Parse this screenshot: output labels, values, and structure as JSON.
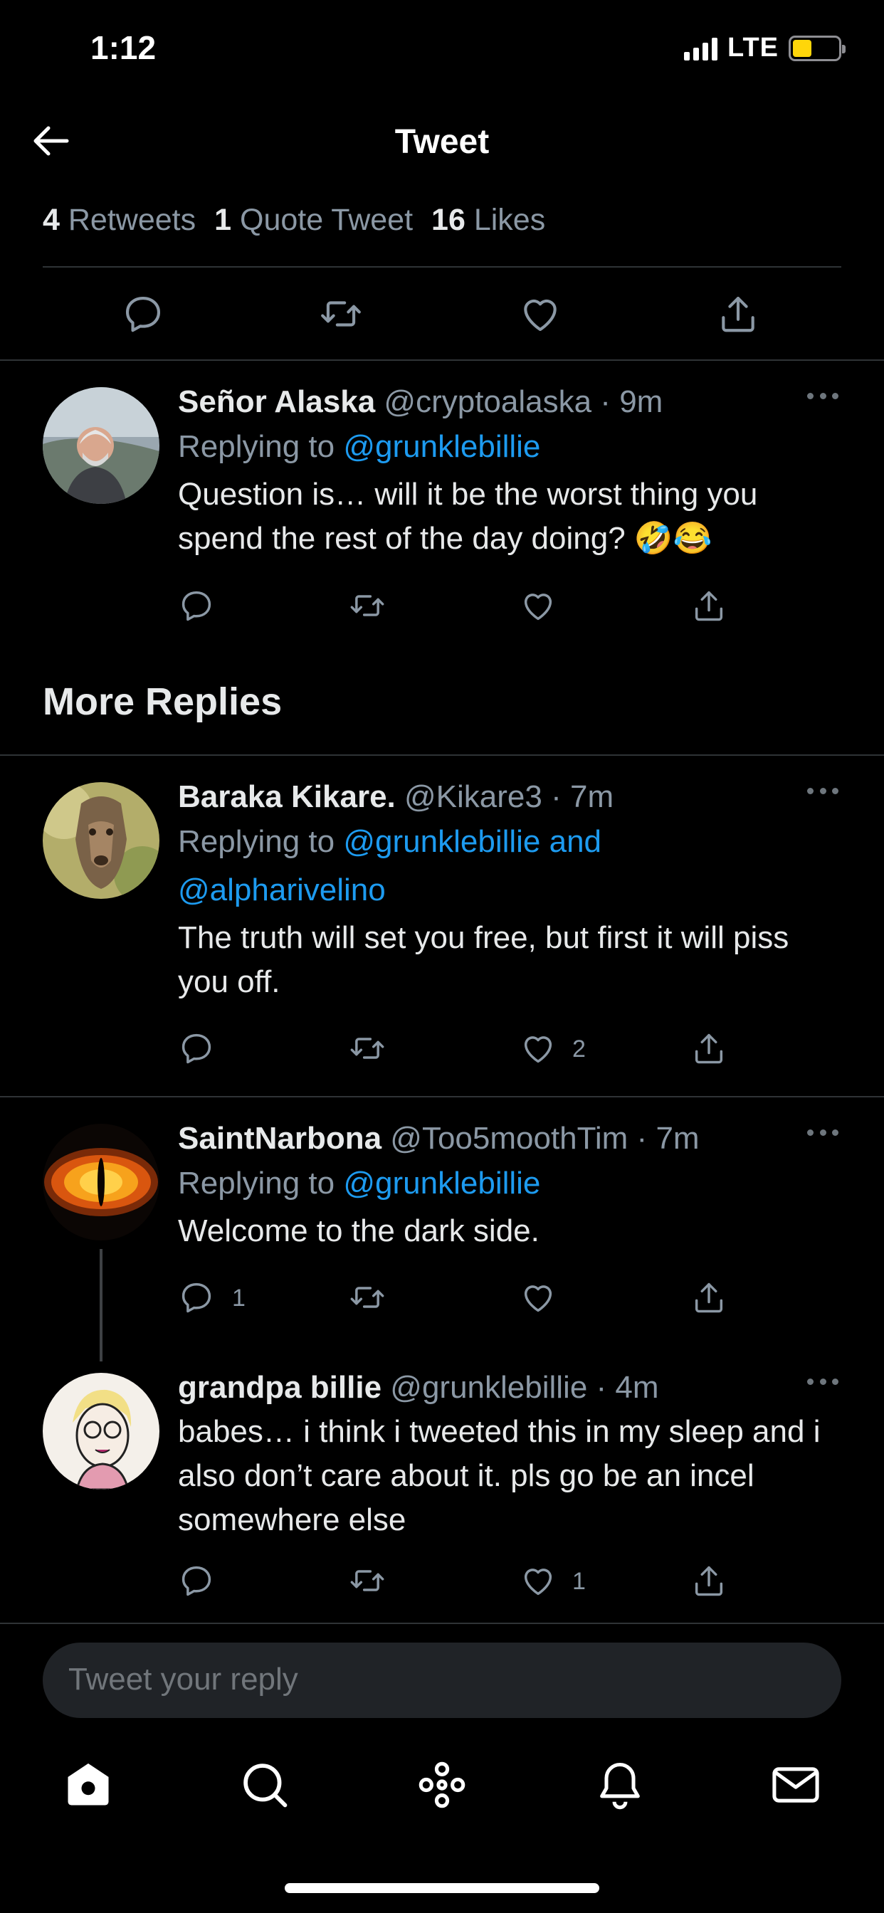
{
  "status_bar": {
    "time": "1:12",
    "network": "LTE"
  },
  "nav": {
    "title": "Tweet"
  },
  "stats": [
    {
      "count": "4",
      "label": "Retweets"
    },
    {
      "count": "1",
      "label": "Quote Tweet"
    },
    {
      "count": "16",
      "label": "Likes"
    }
  ],
  "section_title": "More Replies",
  "tweets": [
    {
      "name": "Señor Alaska",
      "handle": "@cryptoalaska",
      "time": "9m",
      "replying_prefix": "Replying to",
      "replying_to": "@grunklebillie",
      "text": "Question is… will it be the worst thing you spend the rest of the day doing? 🤣😂",
      "reply_count": "",
      "like_count": ""
    },
    {
      "name": "Baraka Kikare.",
      "handle": "@Kikare3",
      "time": "7m",
      "replying_prefix": "Replying to",
      "replying_to": "@grunklebillie and @alpharivelino",
      "text": "The truth will set you free, but first it will piss you off.",
      "reply_count": "",
      "like_count": "2"
    },
    {
      "name": "SaintNarbona",
      "handle": "@Too5moothTim",
      "time": "7m",
      "replying_prefix": "Replying to",
      "replying_to": "@grunklebillie",
      "text": "Welcome to the dark side.",
      "reply_count": "1",
      "like_count": ""
    },
    {
      "name": "grandpa billie",
      "handle": "@grunklebillie",
      "time": "4m",
      "text": "babes… i think i tweeted this in my sleep and i also don’t care about it. pls go be an incel somewhere else",
      "reply_count": "",
      "like_count": "1"
    }
  ],
  "reply_box": {
    "placeholder": "Tweet your reply"
  },
  "tabs": [
    "home-icon",
    "search-icon",
    "spaces-icon",
    "notifications-icon",
    "messages-icon"
  ],
  "colors": {
    "background": "#000000",
    "link": "#1d9bf0",
    "muted": "#8b98a5",
    "battery": "#ffd60a"
  }
}
